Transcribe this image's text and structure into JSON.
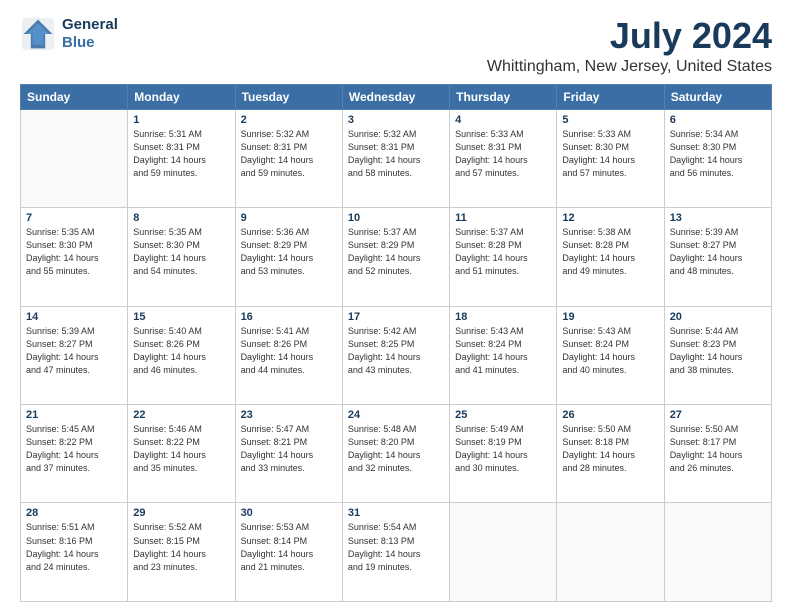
{
  "logo": {
    "line1": "General",
    "line2": "Blue"
  },
  "title": "July 2024",
  "subtitle": "Whittingham, New Jersey, United States",
  "weekdays": [
    "Sunday",
    "Monday",
    "Tuesday",
    "Wednesday",
    "Thursday",
    "Friday",
    "Saturday"
  ],
  "weeks": [
    [
      {
        "day": "",
        "info": ""
      },
      {
        "day": "1",
        "info": "Sunrise: 5:31 AM\nSunset: 8:31 PM\nDaylight: 14 hours\nand 59 minutes."
      },
      {
        "day": "2",
        "info": "Sunrise: 5:32 AM\nSunset: 8:31 PM\nDaylight: 14 hours\nand 59 minutes."
      },
      {
        "day": "3",
        "info": "Sunrise: 5:32 AM\nSunset: 8:31 PM\nDaylight: 14 hours\nand 58 minutes."
      },
      {
        "day": "4",
        "info": "Sunrise: 5:33 AM\nSunset: 8:31 PM\nDaylight: 14 hours\nand 57 minutes."
      },
      {
        "day": "5",
        "info": "Sunrise: 5:33 AM\nSunset: 8:30 PM\nDaylight: 14 hours\nand 57 minutes."
      },
      {
        "day": "6",
        "info": "Sunrise: 5:34 AM\nSunset: 8:30 PM\nDaylight: 14 hours\nand 56 minutes."
      }
    ],
    [
      {
        "day": "7",
        "info": "Sunrise: 5:35 AM\nSunset: 8:30 PM\nDaylight: 14 hours\nand 55 minutes."
      },
      {
        "day": "8",
        "info": "Sunrise: 5:35 AM\nSunset: 8:30 PM\nDaylight: 14 hours\nand 54 minutes."
      },
      {
        "day": "9",
        "info": "Sunrise: 5:36 AM\nSunset: 8:29 PM\nDaylight: 14 hours\nand 53 minutes."
      },
      {
        "day": "10",
        "info": "Sunrise: 5:37 AM\nSunset: 8:29 PM\nDaylight: 14 hours\nand 52 minutes."
      },
      {
        "day": "11",
        "info": "Sunrise: 5:37 AM\nSunset: 8:28 PM\nDaylight: 14 hours\nand 51 minutes."
      },
      {
        "day": "12",
        "info": "Sunrise: 5:38 AM\nSunset: 8:28 PM\nDaylight: 14 hours\nand 49 minutes."
      },
      {
        "day": "13",
        "info": "Sunrise: 5:39 AM\nSunset: 8:27 PM\nDaylight: 14 hours\nand 48 minutes."
      }
    ],
    [
      {
        "day": "14",
        "info": "Sunrise: 5:39 AM\nSunset: 8:27 PM\nDaylight: 14 hours\nand 47 minutes."
      },
      {
        "day": "15",
        "info": "Sunrise: 5:40 AM\nSunset: 8:26 PM\nDaylight: 14 hours\nand 46 minutes."
      },
      {
        "day": "16",
        "info": "Sunrise: 5:41 AM\nSunset: 8:26 PM\nDaylight: 14 hours\nand 44 minutes."
      },
      {
        "day": "17",
        "info": "Sunrise: 5:42 AM\nSunset: 8:25 PM\nDaylight: 14 hours\nand 43 minutes."
      },
      {
        "day": "18",
        "info": "Sunrise: 5:43 AM\nSunset: 8:24 PM\nDaylight: 14 hours\nand 41 minutes."
      },
      {
        "day": "19",
        "info": "Sunrise: 5:43 AM\nSunset: 8:24 PM\nDaylight: 14 hours\nand 40 minutes."
      },
      {
        "day": "20",
        "info": "Sunrise: 5:44 AM\nSunset: 8:23 PM\nDaylight: 14 hours\nand 38 minutes."
      }
    ],
    [
      {
        "day": "21",
        "info": "Sunrise: 5:45 AM\nSunset: 8:22 PM\nDaylight: 14 hours\nand 37 minutes."
      },
      {
        "day": "22",
        "info": "Sunrise: 5:46 AM\nSunset: 8:22 PM\nDaylight: 14 hours\nand 35 minutes."
      },
      {
        "day": "23",
        "info": "Sunrise: 5:47 AM\nSunset: 8:21 PM\nDaylight: 14 hours\nand 33 minutes."
      },
      {
        "day": "24",
        "info": "Sunrise: 5:48 AM\nSunset: 8:20 PM\nDaylight: 14 hours\nand 32 minutes."
      },
      {
        "day": "25",
        "info": "Sunrise: 5:49 AM\nSunset: 8:19 PM\nDaylight: 14 hours\nand 30 minutes."
      },
      {
        "day": "26",
        "info": "Sunrise: 5:50 AM\nSunset: 8:18 PM\nDaylight: 14 hours\nand 28 minutes."
      },
      {
        "day": "27",
        "info": "Sunrise: 5:50 AM\nSunset: 8:17 PM\nDaylight: 14 hours\nand 26 minutes."
      }
    ],
    [
      {
        "day": "28",
        "info": "Sunrise: 5:51 AM\nSunset: 8:16 PM\nDaylight: 14 hours\nand 24 minutes."
      },
      {
        "day": "29",
        "info": "Sunrise: 5:52 AM\nSunset: 8:15 PM\nDaylight: 14 hours\nand 23 minutes."
      },
      {
        "day": "30",
        "info": "Sunrise: 5:53 AM\nSunset: 8:14 PM\nDaylight: 14 hours\nand 21 minutes."
      },
      {
        "day": "31",
        "info": "Sunrise: 5:54 AM\nSunset: 8:13 PM\nDaylight: 14 hours\nand 19 minutes."
      },
      {
        "day": "",
        "info": ""
      },
      {
        "day": "",
        "info": ""
      },
      {
        "day": "",
        "info": ""
      }
    ]
  ]
}
